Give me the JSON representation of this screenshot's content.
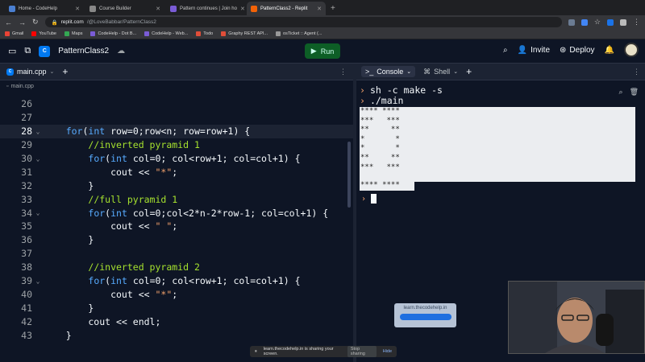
{
  "browser": {
    "tabs": [
      {
        "title": "Home - CodeHelp",
        "color": "#4a7fd1"
      },
      {
        "title": "Course Builder",
        "color": "#888888"
      },
      {
        "title": "Pattern continues | Join ho",
        "color": "#7a5cd6"
      },
      {
        "title": "PatternClass2 - Replit",
        "color": "#f26207"
      }
    ],
    "address": {
      "host": "replit.com",
      "path": "/@LoveBabbar/PatternClass2"
    },
    "bookmarks": [
      "Gmail",
      "YouTube",
      "Maps",
      "CodeHelp - Dot B...",
      "CodeHelp - Web...",
      "Todo",
      "Graphy REST API...",
      "osTicket :: Agent (..."
    ]
  },
  "replit": {
    "project_name": "PatternClass2",
    "run_label": "Run",
    "invite_label": "Invite",
    "deploy_label": "Deploy"
  },
  "editor": {
    "tab_label": "main.cpp",
    "breadcrumb": "main.cpp",
    "lines": [
      {
        "n": "26",
        "fold": false,
        "cur": false,
        "tokens": []
      },
      {
        "n": "27",
        "fold": false,
        "cur": false,
        "tokens": []
      },
      {
        "n": "28",
        "fold": true,
        "cur": true,
        "tokens": [
          [
            "txt",
            "    "
          ],
          [
            "kw",
            "for"
          ],
          [
            "txt",
            "("
          ],
          [
            "kw",
            "int"
          ],
          [
            "txt",
            " row=0;row<n; row=row+1) {"
          ]
        ]
      },
      {
        "n": "29",
        "fold": false,
        "cur": false,
        "tokens": [
          [
            "txt",
            "        "
          ],
          [
            "com",
            "//inverted pyramid 1"
          ]
        ]
      },
      {
        "n": "30",
        "fold": true,
        "cur": false,
        "tokens": [
          [
            "txt",
            "        "
          ],
          [
            "kw",
            "for"
          ],
          [
            "txt",
            "("
          ],
          [
            "kw",
            "int"
          ],
          [
            "txt",
            " col=0; col<row+1; col=col+1) {"
          ]
        ]
      },
      {
        "n": "31",
        "fold": false,
        "cur": false,
        "tokens": [
          [
            "txt",
            "            cout << "
          ],
          [
            "str",
            "\"*\""
          ],
          [
            "txt",
            ";"
          ]
        ]
      },
      {
        "n": "32",
        "fold": false,
        "cur": false,
        "tokens": [
          [
            "txt",
            "        }"
          ]
        ]
      },
      {
        "n": "33",
        "fold": false,
        "cur": false,
        "tokens": [
          [
            "txt",
            "        "
          ],
          [
            "com",
            "//full pyramid 1"
          ]
        ]
      },
      {
        "n": "34",
        "fold": true,
        "cur": false,
        "tokens": [
          [
            "txt",
            "        "
          ],
          [
            "kw",
            "for"
          ],
          [
            "txt",
            "("
          ],
          [
            "kw",
            "int"
          ],
          [
            "txt",
            " col=0;col<2*n-2*row-1; col=col+1) {"
          ]
        ]
      },
      {
        "n": "35",
        "fold": false,
        "cur": false,
        "tokens": [
          [
            "txt",
            "            cout << "
          ],
          [
            "str",
            "\" \""
          ],
          [
            "txt",
            ";"
          ]
        ]
      },
      {
        "n": "36",
        "fold": false,
        "cur": false,
        "tokens": [
          [
            "txt",
            "        }"
          ]
        ]
      },
      {
        "n": "37",
        "fold": false,
        "cur": false,
        "tokens": []
      },
      {
        "n": "38",
        "fold": false,
        "cur": false,
        "tokens": [
          [
            "txt",
            "        "
          ],
          [
            "com",
            "//inverted pyramid 2"
          ]
        ]
      },
      {
        "n": "39",
        "fold": true,
        "cur": false,
        "tokens": [
          [
            "txt",
            "        "
          ],
          [
            "kw",
            "for"
          ],
          [
            "txt",
            "("
          ],
          [
            "kw",
            "int"
          ],
          [
            "txt",
            " col=0; col<row+1; col=col+1) {"
          ]
        ]
      },
      {
        "n": "40",
        "fold": false,
        "cur": false,
        "tokens": [
          [
            "txt",
            "            cout << "
          ],
          [
            "str",
            "\"*\""
          ],
          [
            "txt",
            ";"
          ]
        ]
      },
      {
        "n": "41",
        "fold": false,
        "cur": false,
        "tokens": [
          [
            "txt",
            "        }"
          ]
        ]
      },
      {
        "n": "42",
        "fold": false,
        "cur": false,
        "tokens": [
          [
            "txt",
            "        cout << endl;"
          ]
        ]
      },
      {
        "n": "43",
        "fold": false,
        "cur": false,
        "tokens": [
          [
            "txt",
            "    }"
          ]
        ]
      }
    ]
  },
  "console": {
    "tab_console": "Console",
    "tab_shell": "Shell",
    "commands": [
      "sh -c make -s",
      "./main"
    ],
    "output": [
      "**** ****",
      "***   ***",
      "**     **",
      "*       *",
      "*       *",
      "**     **",
      "***   ***",
      "**** ****"
    ]
  },
  "overlay": {
    "watermark_text": "learn.thecodehelp.in",
    "share_text": "learn.thecodehelp.in is sharing your screen.",
    "stop_label": "Stop sharing",
    "hide_label": "Hide"
  }
}
